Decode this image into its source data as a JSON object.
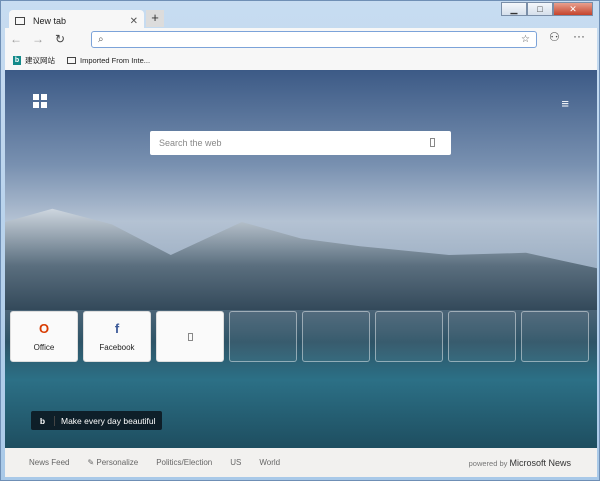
{
  "window": {
    "minimize": "▁",
    "maximize": "□",
    "close": "✕"
  },
  "tab": {
    "title": "New tab",
    "close": "✕",
    "new_tab": "+"
  },
  "toolbar": {
    "back": "←",
    "forward": "→",
    "refresh": "↻",
    "address_placeholder": "",
    "search_icon": "⌕",
    "star": "☆",
    "profile": "⚇",
    "more": "···"
  },
  "bookmarks": [
    {
      "label": "建议网站",
      "icon": "b"
    },
    {
      "label": "Imported From Inte..."
    }
  ],
  "page": {
    "search_placeholder": "Search the web",
    "menu": "≡",
    "tiles": [
      {
        "label": "Office",
        "glyph": "O"
      },
      {
        "label": "Facebook",
        "glyph": "f"
      },
      {
        "label": ""
      }
    ],
    "daily": {
      "icon": "b",
      "text": "Make every day beautiful"
    }
  },
  "news": {
    "items": [
      "News Feed",
      "✎ Personalize",
      "Politics/Election",
      "US",
      "World"
    ],
    "powered": "powered by",
    "brand": "Microsoft News"
  }
}
